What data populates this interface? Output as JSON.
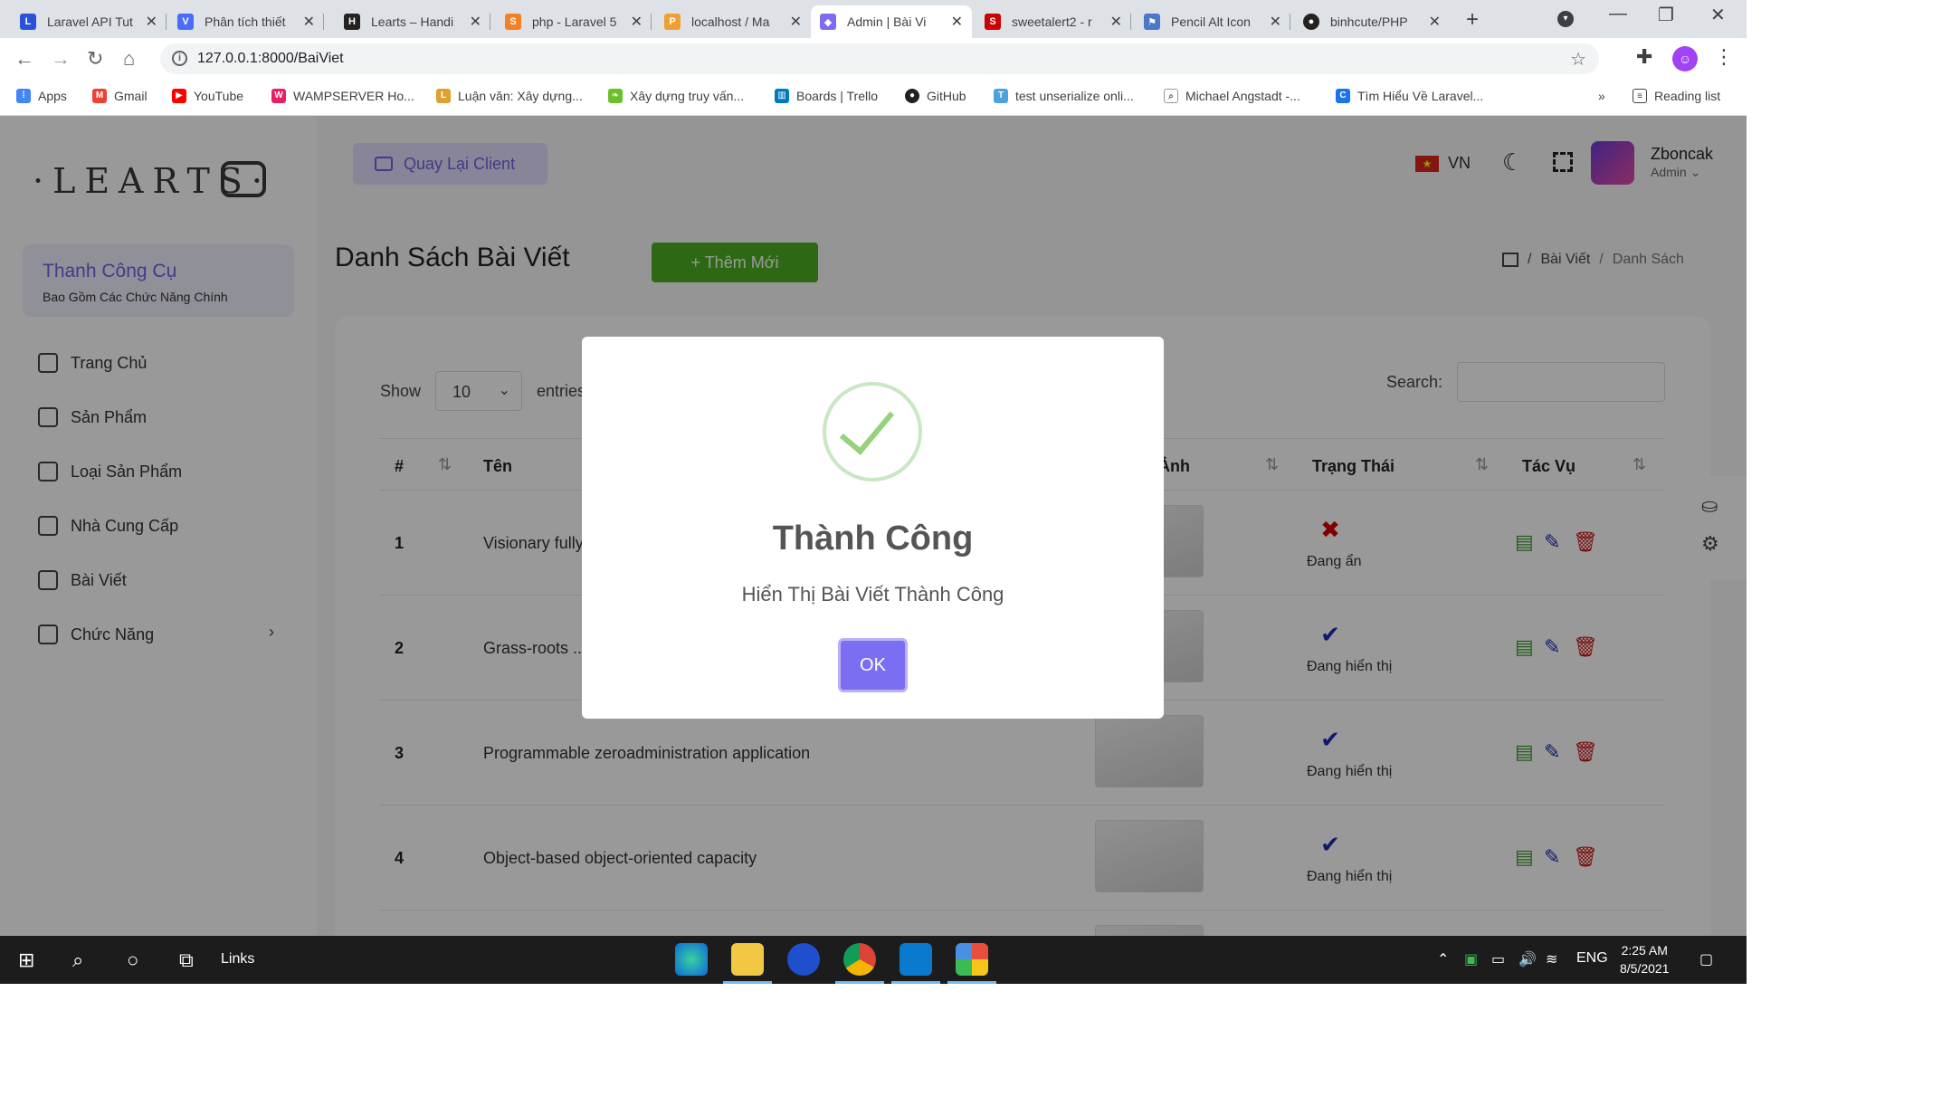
{
  "browser": {
    "tabs": [
      {
        "title": "Laravel API Tut",
        "color": "#2a52d6"
      },
      {
        "title": "Phân tích thiết",
        "color": "#4a6cf7"
      },
      {
        "title": "Learts – Handi",
        "color": "#222222"
      },
      {
        "title": "php - Laravel 5",
        "color": "#f48024"
      },
      {
        "title": "localhost / Ma",
        "color": "#f0a030"
      },
      {
        "title": "Admin | Bài Vi",
        "color": "#7b6cf0"
      },
      {
        "title": "sweetalert2 - r",
        "color": "#cc0000"
      },
      {
        "title": "Pencil Alt Icon",
        "color": "#4a78c8"
      },
      {
        "title": "binhcute/PHP",
        "color": "#222222"
      }
    ],
    "url": "127.0.0.1:8000/BaiViet",
    "bookmarks": [
      "Apps",
      "Gmail",
      "YouTube",
      "WAMPSERVER Ho...",
      "Luận văn: Xây dựng...",
      "Xây dựng truy vấn...",
      "Boards | Trello",
      "GitHub",
      "test unserialize onli...",
      "Michael Angstadt -...",
      "Tìm Hiểu Về Laravel..."
    ],
    "more": "»",
    "reading_list": "Reading list"
  },
  "sidebar": {
    "logo": "·LEARTS·",
    "tool_title": "Thanh Công Cụ",
    "tool_subtitle": "Bao Gồm Các Chức Năng Chính",
    "menu": [
      {
        "label": "Trang Chủ"
      },
      {
        "label": "Sản Phẩm"
      },
      {
        "label": "Loại Sản Phẩm"
      },
      {
        "label": "Nhà Cung Cấp"
      },
      {
        "label": "Bài Viết"
      },
      {
        "label": "Chức Năng"
      }
    ]
  },
  "header": {
    "back_button": "Quay Lại Client",
    "lang": "VN",
    "user_name": "Zboncak",
    "user_role": "Admin"
  },
  "content": {
    "title": "Danh Sách Bài Viết",
    "add_button": "+ Thêm Mới",
    "breadcrumb": [
      "Bài Viết",
      "Danh Sách"
    ],
    "show_label": "Show",
    "show_value": "10",
    "entries_label": "entries",
    "search_label": "Search:",
    "columns": [
      "#",
      "Tên",
      "Ảnh",
      "Trạng Thái",
      "Tác Vụ"
    ],
    "rows": [
      {
        "num": "1",
        "name": "Visionary fully-configurable...",
        "status": "Đang ẩn",
        "status_icon": "x-icon"
      },
      {
        "num": "2",
        "name": "Grass-roots ...",
        "status": "Đang hiển thị",
        "status_icon": "check-icon"
      },
      {
        "num": "3",
        "name": "Programmable zeroadministration application",
        "status": "Đang hiển thị",
        "status_icon": "check-icon"
      },
      {
        "num": "4",
        "name": "Object-based object-oriented capacity",
        "status": "Đang hiển thị",
        "status_icon": "check-icon"
      }
    ]
  },
  "modal": {
    "title": "Thành Công",
    "text": "Hiển Thị Bài Viết Thành Công",
    "ok": "OK"
  },
  "taskbar": {
    "links": "Links",
    "lang": "ENG",
    "time": "2:25 AM",
    "date": "8/5/2021"
  }
}
